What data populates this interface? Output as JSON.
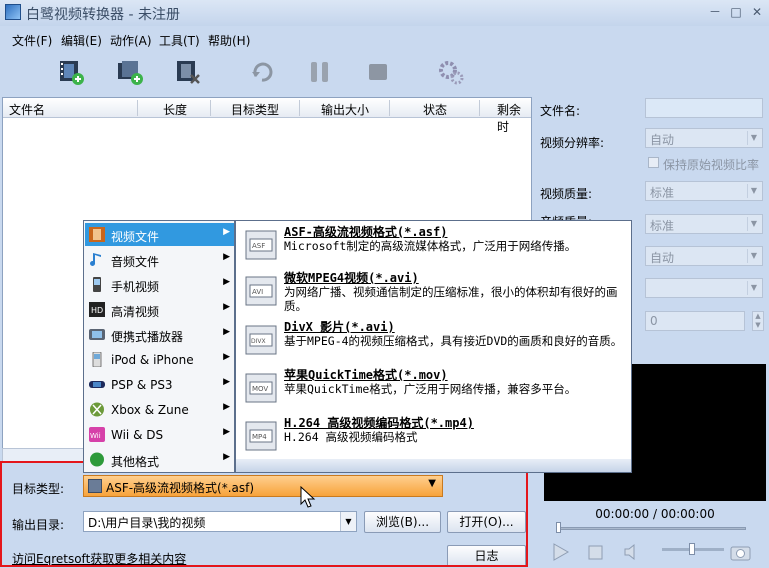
{
  "window": {
    "title": "白鹭视频转换器 - 未注册",
    "min": "－",
    "max": "□",
    "close": "✕"
  },
  "menubar": [
    "文件(F)",
    "编辑(E)",
    "动作(A)",
    "工具(T)",
    "帮助(H)"
  ],
  "toolbar": [
    "add-video-icon",
    "add-folder-icon",
    "remove-icon",
    "refresh-icon",
    "pause-icon",
    "stop-icon",
    "settings-icon"
  ],
  "list": {
    "columns": [
      "文件名",
      "长度",
      "目标类型",
      "输出大小",
      "状态",
      "剩余时"
    ]
  },
  "right": {
    "filename_label": "文件名:",
    "resolution_label": "视频分辨率:",
    "resolution_value": "自动",
    "keep_ratio": "保持原始视频比率",
    "quality_label": "视频质量:",
    "quality_value": "标准",
    "audio_label": "音频质量:",
    "audio_value": "标准",
    "auto2": "自动",
    "zero": "0",
    "time": "00:00:00 / 00:00:00"
  },
  "menu": {
    "items": [
      {
        "label": "视频文件",
        "icon": "film-icon"
      },
      {
        "label": "音频文件",
        "icon": "music-note-icon"
      },
      {
        "label": "手机视频",
        "icon": "phone-icon"
      },
      {
        "label": "高清视频",
        "icon": "hd-icon"
      },
      {
        "label": "便携式播放器",
        "icon": "player-icon"
      },
      {
        "label": "iPod & iPhone",
        "icon": "ipod-icon"
      },
      {
        "label": "PSP & PS3",
        "icon": "psp-icon"
      },
      {
        "label": "Xbox & Zune",
        "icon": "xbox-icon"
      },
      {
        "label": "Wii & DS",
        "icon": "wii-icon"
      },
      {
        "label": "其他格式",
        "icon": "other-format-icon"
      }
    ]
  },
  "formats": [
    {
      "name": "ASF-高级流视频格式(*.asf)",
      "desc": "Microsoft制定的高级流媒体格式，广泛用于网络传播。",
      "tag": "ASF"
    },
    {
      "name": "微软MPEG4视频(*.avi)",
      "desc": "为网络广播、视频通信制定的压缩标准，很小的体积却有很好的画质。",
      "tag": "AVI"
    },
    {
      "name": "DivX 影片(*.avi)",
      "desc": "基于MPEG-4的视频压缩格式，具有接近DVD的画质和良好的音质。",
      "tag": "DIVX"
    },
    {
      "name": "苹果QuickTime格式(*.mov)",
      "desc": "苹果QuickTime格式，广泛用于网络传播，兼容多平台。",
      "tag": "MOV"
    },
    {
      "name": "H.264 高级视频编码格式(*.mp4)",
      "desc": "H.264 高级视频编码格式",
      "tag": "MP4"
    }
  ],
  "bottom": {
    "target_label": "目标类型:",
    "target_value": "ASF-高级流视频格式(*.asf)",
    "output_label": "输出目录:",
    "output_value": "D:\\用户目录\\我的视频",
    "browse": "浏览(B)...",
    "open": "打开(O)...",
    "link": "访问Eqretsoft获取更多相关内容",
    "log": "日志"
  }
}
